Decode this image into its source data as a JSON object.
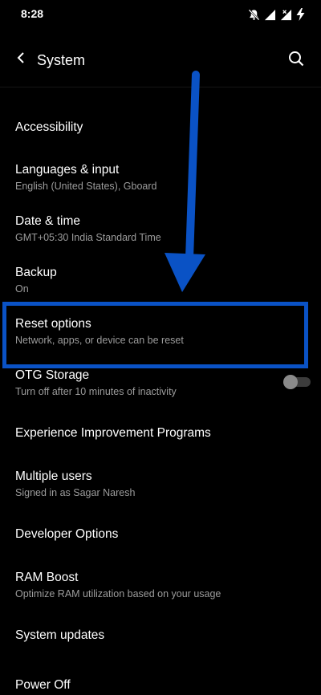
{
  "status_bar": {
    "time": "8:28",
    "icons": [
      "mute-bell-icon",
      "signal-icon",
      "signal-no-data-icon",
      "charging-bolt-icon"
    ]
  },
  "app_bar": {
    "title": "System",
    "back_icon": "back-arrow-icon",
    "search_icon": "search-icon"
  },
  "settings": {
    "accessibility": {
      "title": "Accessibility"
    },
    "languages": {
      "title": "Languages & input",
      "subtitle": "English (United States), Gboard"
    },
    "date_time": {
      "title": "Date & time",
      "subtitle": "GMT+05:30 India Standard Time"
    },
    "backup": {
      "title": "Backup",
      "subtitle": "On"
    },
    "reset": {
      "title": "Reset options",
      "subtitle": "Network, apps, or device can be reset"
    },
    "otg": {
      "title": "OTG Storage",
      "subtitle": "Turn off after 10 minutes of inactivity",
      "enabled": false
    },
    "experience": {
      "title": "Experience Improvement Programs"
    },
    "multiple_users": {
      "title": "Multiple users",
      "subtitle": "Signed in as Sagar Naresh"
    },
    "developer": {
      "title": "Developer Options"
    },
    "ram_boost": {
      "title": "RAM Boost",
      "subtitle": "Optimize RAM utilization based on your usage"
    },
    "system_updates": {
      "title": "System updates"
    },
    "power_off": {
      "title": "Power Off"
    }
  },
  "annotation": {
    "color": "#0a52c5",
    "arrow": "down-arrow-annotation",
    "highlight": "reset-options-highlight"
  },
  "colors": {
    "background": "#000000",
    "primary_text": "#ffffff",
    "secondary_text": "#9c9c9c",
    "toggle_off": "#8a8a8a"
  }
}
